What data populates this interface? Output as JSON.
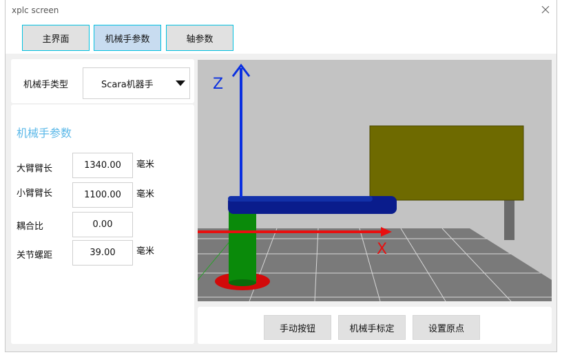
{
  "window": {
    "title": "xplc screen",
    "close_glyph": "×"
  },
  "tabs": [
    {
      "label": "主界面",
      "active": false
    },
    {
      "label": "机械手参数",
      "active": true
    },
    {
      "label": "轴参数",
      "active": false
    }
  ],
  "robot_type": {
    "label": "机械手类型",
    "selected": "Scara机器手"
  },
  "params": {
    "title": "机械手参数",
    "fields": [
      {
        "label": "大臂臂长",
        "value": "1340.00",
        "unit": "毫米"
      },
      {
        "label": "小臂臂长",
        "value": "1100.00",
        "unit": "毫米"
      },
      {
        "label": "耦合比",
        "value": "0.00",
        "unit": ""
      },
      {
        "label": "关节螺距",
        "value": "39.00",
        "unit": "毫米"
      }
    ]
  },
  "scene": {
    "axis_z_label": "Z",
    "axis_x_label": "X",
    "colors": {
      "background": "#c3c3c3",
      "floor": "#7a7a7a",
      "z_axis": "#0a2fe0",
      "x_axis": "#e81010",
      "arm": "#0a1c8c",
      "base": "#0a8a0a",
      "base_disc": "#d20a0a",
      "workpiece": "#6e6a00"
    }
  },
  "actions": {
    "manual_buttons": "手动按钮",
    "calibrate": "机械手标定",
    "set_origin": "设置原点"
  }
}
